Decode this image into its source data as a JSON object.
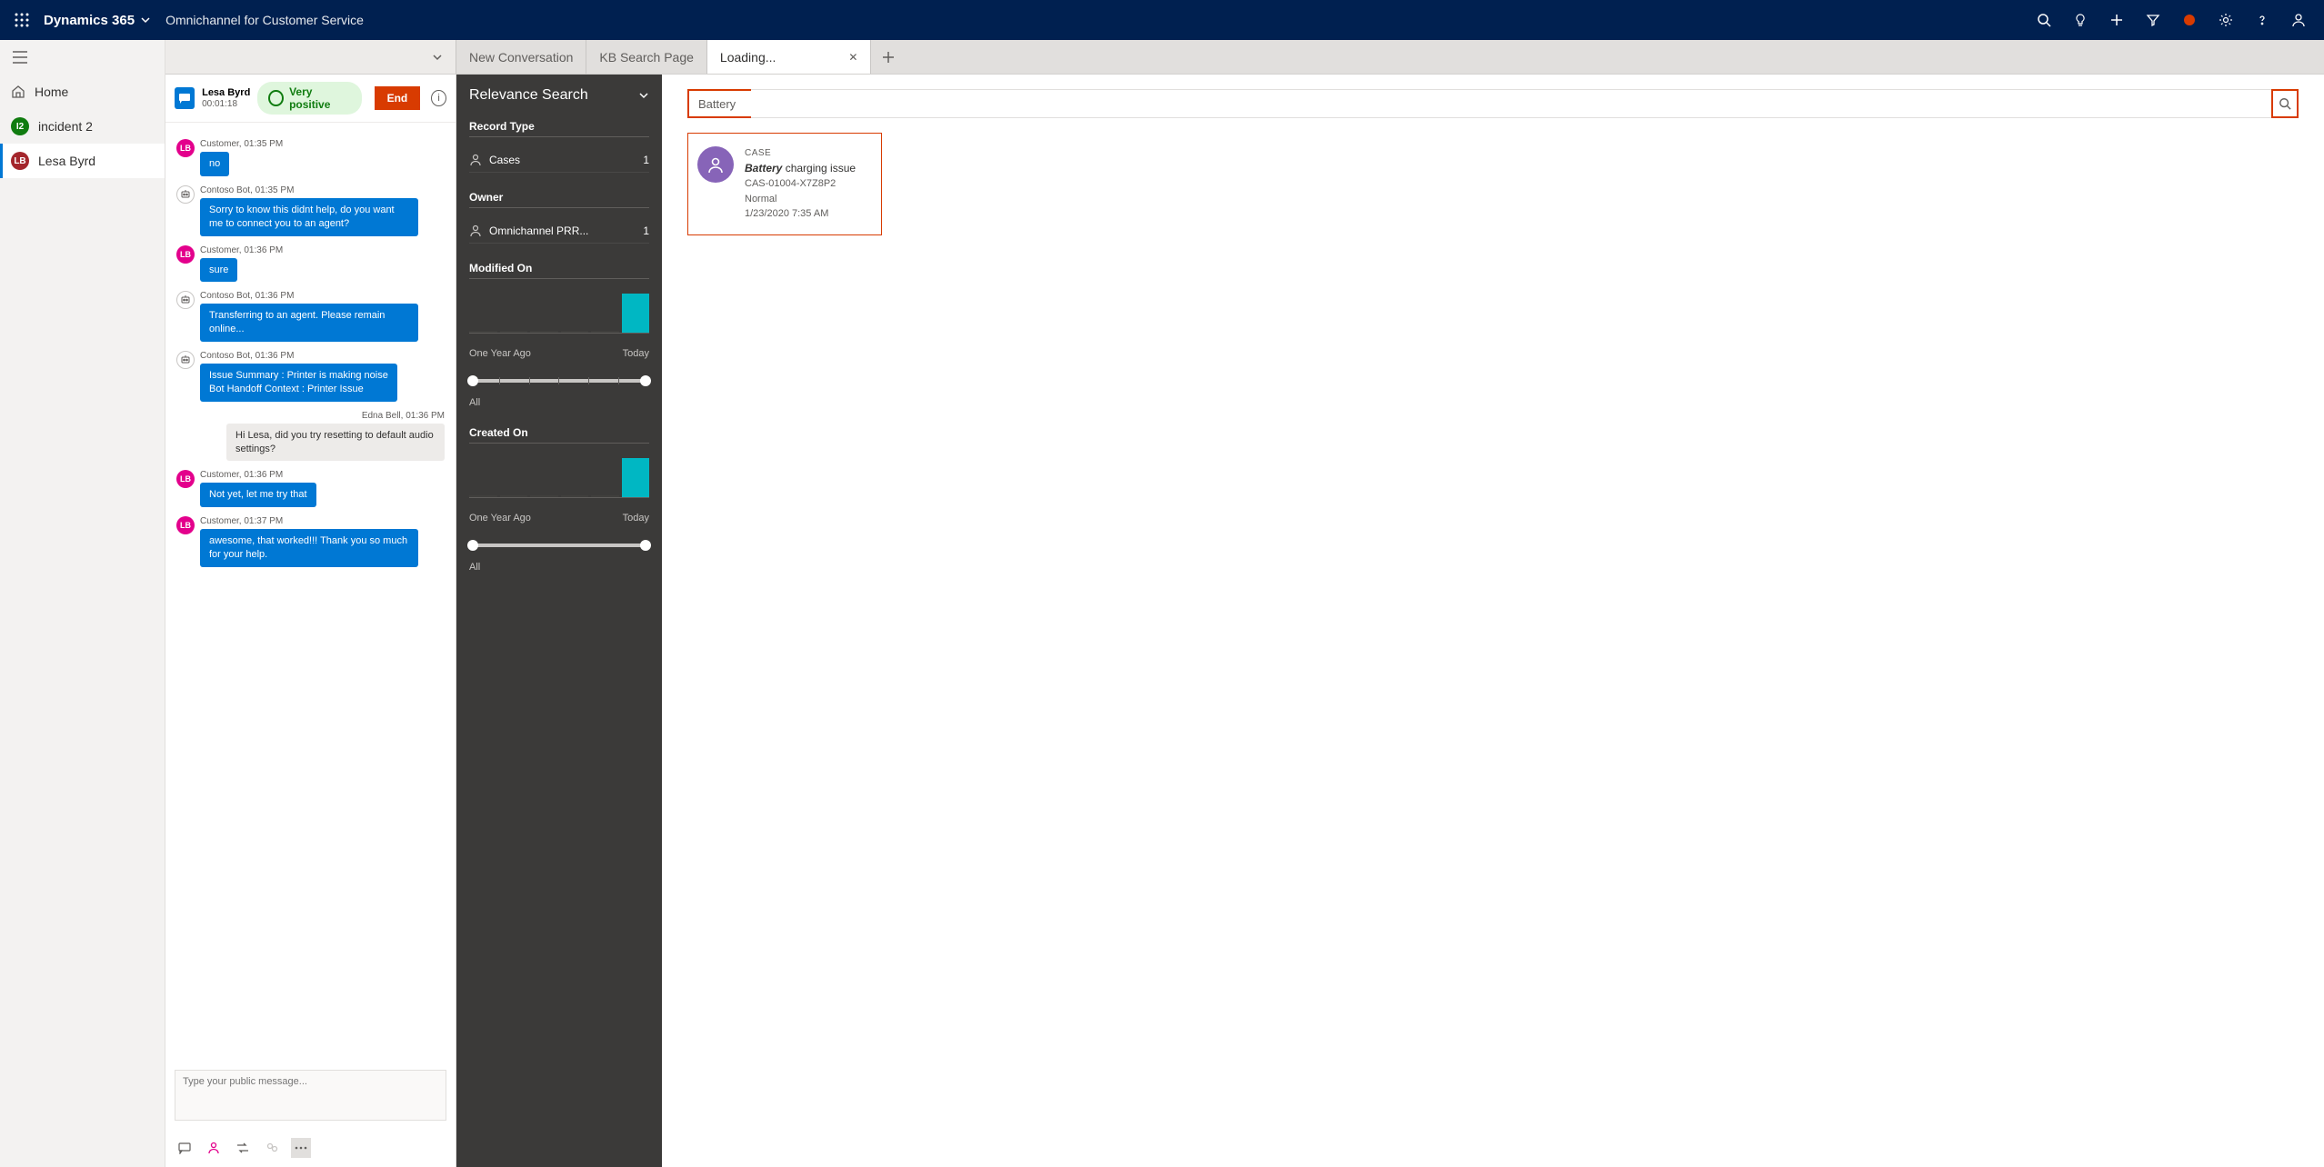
{
  "topnav": {
    "brand": "Dynamics 365",
    "subtitle": "Omnichannel for Customer Service"
  },
  "sidebar": {
    "home": "Home",
    "items": [
      {
        "label": "incident 2",
        "avatar": "I2",
        "color": "green"
      },
      {
        "label": "Lesa Byrd",
        "avatar": "LB",
        "color": "red",
        "active": true
      }
    ]
  },
  "tabs": {
    "items": [
      {
        "label": "New Conversation"
      },
      {
        "label": "KB Search Page"
      },
      {
        "label": "Loading...",
        "active": true,
        "closable": true
      }
    ]
  },
  "chat": {
    "header": {
      "name": "Lesa Byrd",
      "timer": "00:01:18",
      "sentiment": "Very positive",
      "end": "End"
    },
    "messages": [
      {
        "who": "cust",
        "av": "LB",
        "meta": "Customer, 01:35 PM",
        "text": "no"
      },
      {
        "who": "bot",
        "meta": "Contoso Bot, 01:35 PM",
        "text": "Sorry to know this didnt help, do you want me to connect you to an agent?"
      },
      {
        "who": "cust",
        "av": "LB",
        "meta": "Customer, 01:36 PM",
        "text": "sure"
      },
      {
        "who": "bot",
        "meta": "Contoso Bot, 01:36 PM",
        "text": "Transferring to an agent. Please remain online..."
      },
      {
        "who": "bot",
        "meta": "Contoso Bot, 01:36 PM",
        "text": "Issue Summary : Printer is making noise\nBot Handoff Context : Printer Issue"
      },
      {
        "who": "agent",
        "meta": "Edna Bell,  01:36 PM",
        "text": "Hi Lesa, did you try resetting to default audio settings?"
      },
      {
        "who": "cust",
        "av": "LB",
        "meta": "Customer, 01:36 PM",
        "text": "Not yet, let me try that"
      },
      {
        "who": "cust",
        "av": "LB",
        "meta": "Customer, 01:37 PM",
        "text": "awesome, that worked!!! Thank you so much for your help."
      }
    ],
    "input_placeholder": "Type your public message..."
  },
  "relevance": {
    "title": "Relevance Search",
    "record_type": "Record Type",
    "cases": {
      "label": "Cases",
      "count": "1"
    },
    "owner_label": "Owner",
    "owner": {
      "label": "Omnichannel PRR...",
      "count": "1"
    },
    "modified": "Modified On",
    "created": "Created On",
    "range_from": "One Year Ago",
    "range_to": "Today",
    "all": "All"
  },
  "search": {
    "query": "Battery",
    "result": {
      "label": "CASE",
      "title_bold": "Battery",
      "title_rest": " charging issue",
      "caseNum": "CAS-01004-X7Z8P2",
      "priority": "Normal",
      "date": "1/23/2020 7:35 AM"
    }
  }
}
